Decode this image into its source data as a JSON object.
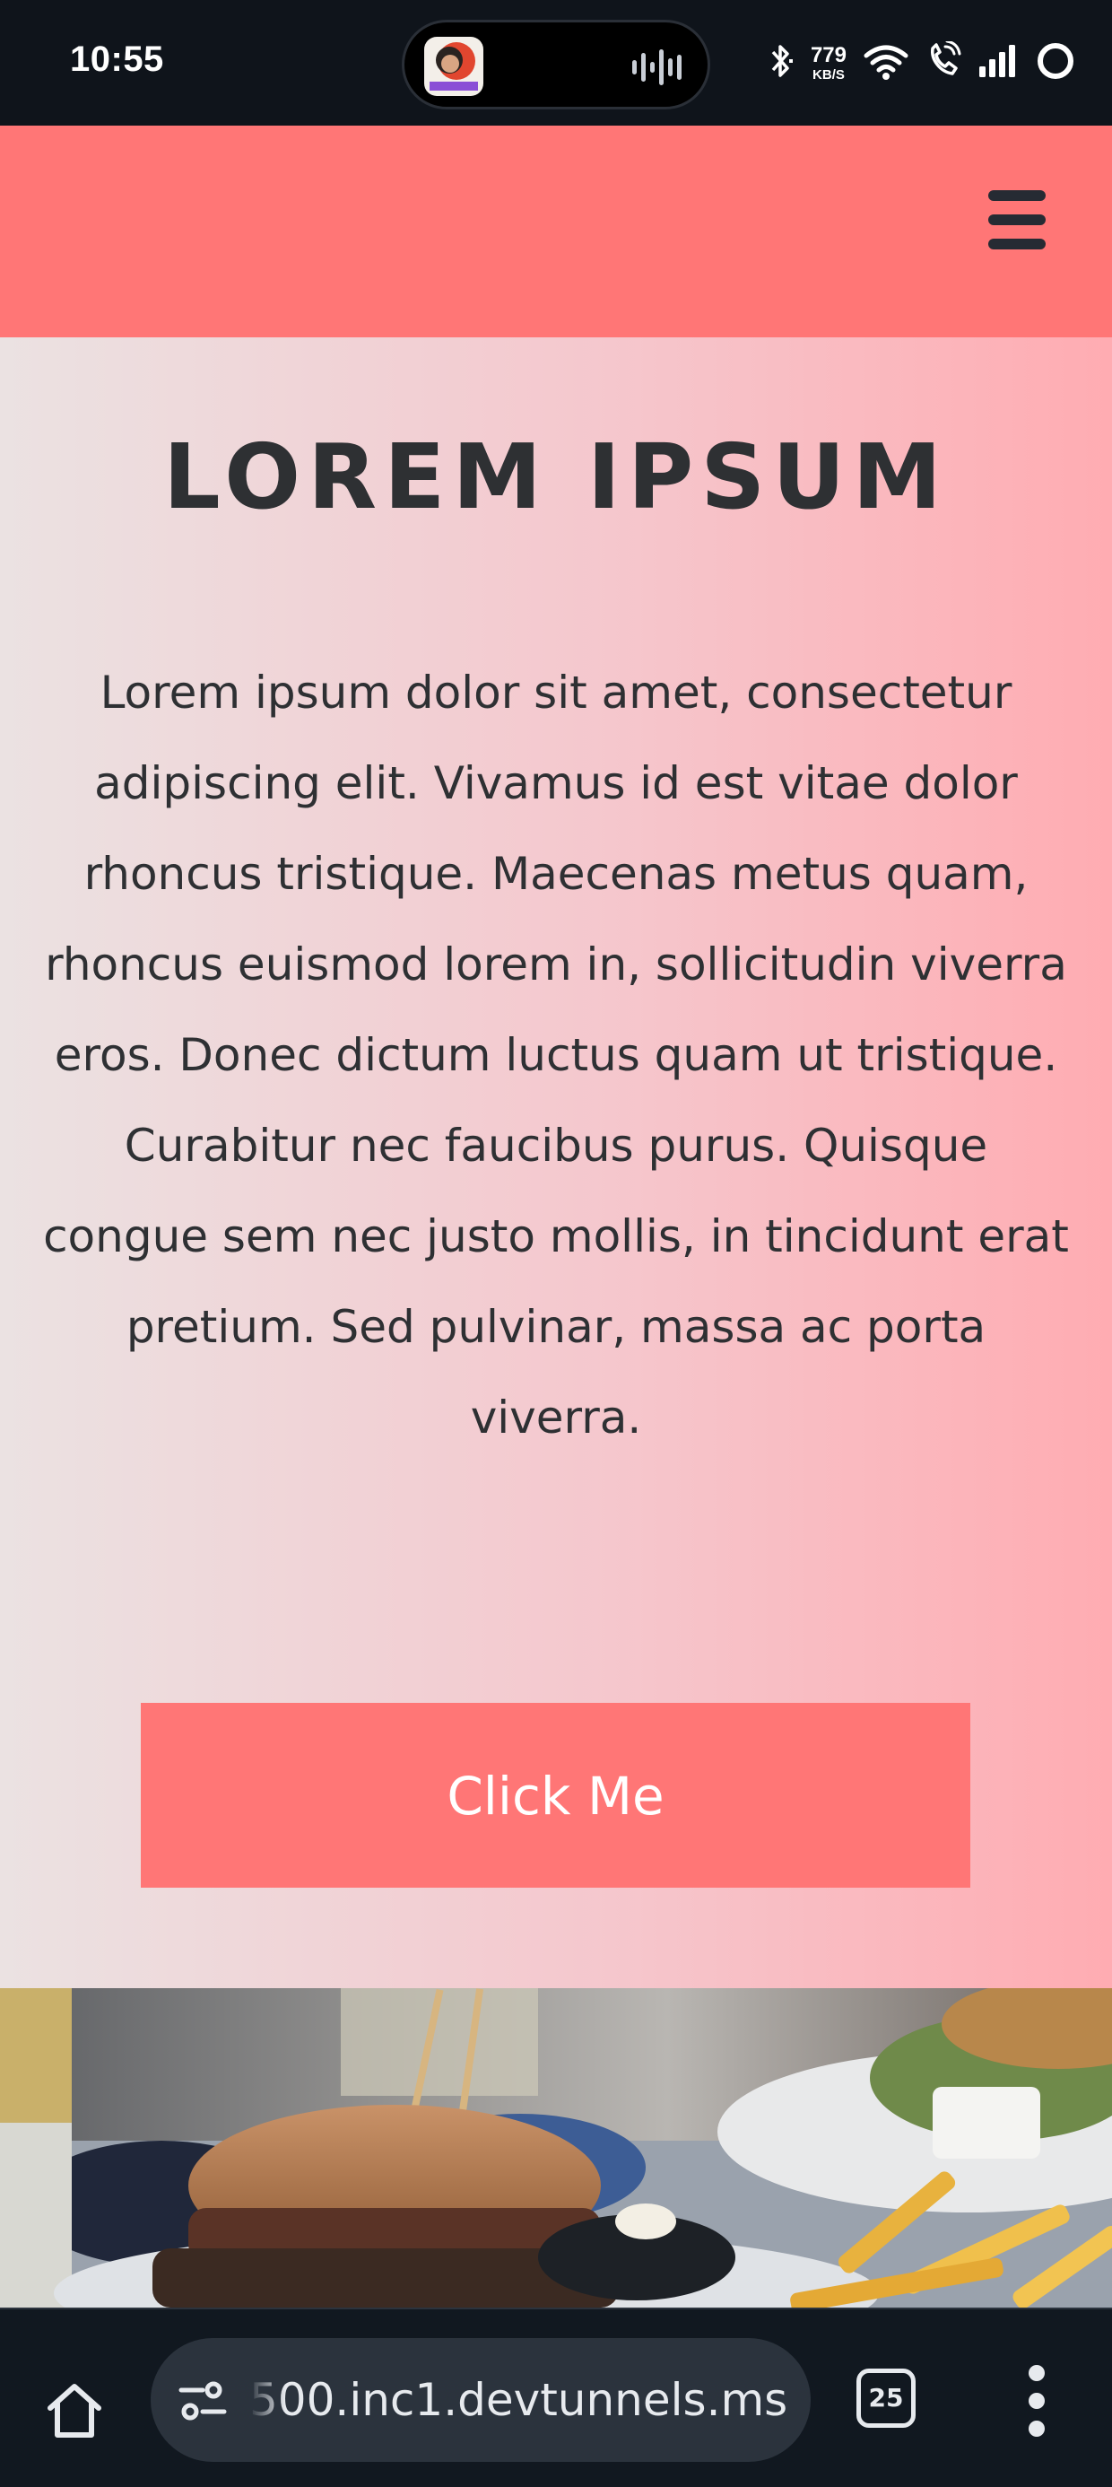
{
  "status_bar": {
    "time": "10:55",
    "net_speed_value": "779",
    "net_speed_unit": "KB/S",
    "icons": [
      "bluetooth-icon",
      "wifi-icon",
      "wifi-call-icon",
      "signal-icon",
      "battery-ring-icon"
    ]
  },
  "header": {
    "menu_icon": "hamburger-icon",
    "background_color": "#ff7676"
  },
  "hero": {
    "title": "LOREM IPSUM",
    "paragraph": "Lorem ipsum dolor sit amet, consectetur adipiscing elit. Vivamus id est vitae dolor rhoncus tristique. Maecenas metus quam, rhoncus euismod lorem in, sollicitudin viverra eros. Donec dictum luctus quam ut tristique. Curabitur nec faucibus purus. Quisque congue sem nec justo mollis, in tincidunt erat pretium. Sed pulvinar, massa ac porta viverra.",
    "button_label": "Click Me",
    "button_color": "#ff7676",
    "text_color": "#2e3033"
  },
  "browser": {
    "url": "500.inc1.devtunnels.ms",
    "tab_count": "25",
    "icons": [
      "home-icon",
      "site-info-icon",
      "tab-switcher-icon",
      "more-menu-icon"
    ]
  }
}
